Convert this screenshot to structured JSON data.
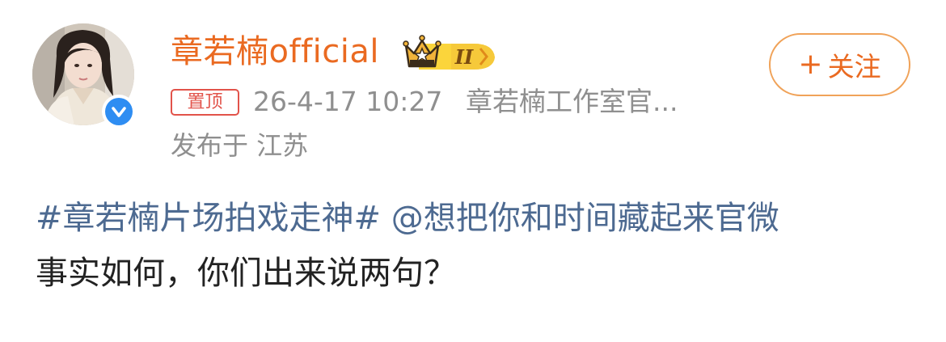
{
  "post": {
    "author_name": "章若楠official",
    "level_badge": "II",
    "follow_plus": "+",
    "follow_label": "关注",
    "pinned_label": "置顶",
    "time": "26-4-17 10:27",
    "source": "章若楠工作室官...",
    "location": "发布于 江苏",
    "hashtag": "#章若楠片场拍戏走神#",
    "mention": "@想把你和时间藏起来官微",
    "body_line_2": "事实如何，你们出来说两句？"
  },
  "icons": {
    "crown": "crown-level-badge-icon",
    "verified": "verified-check-icon"
  },
  "colors": {
    "name": "#ea6a21",
    "link": "#4d6a91",
    "pinned": "#e2534a",
    "verified": "#2e8df2",
    "meta": "#8f8f8f"
  }
}
